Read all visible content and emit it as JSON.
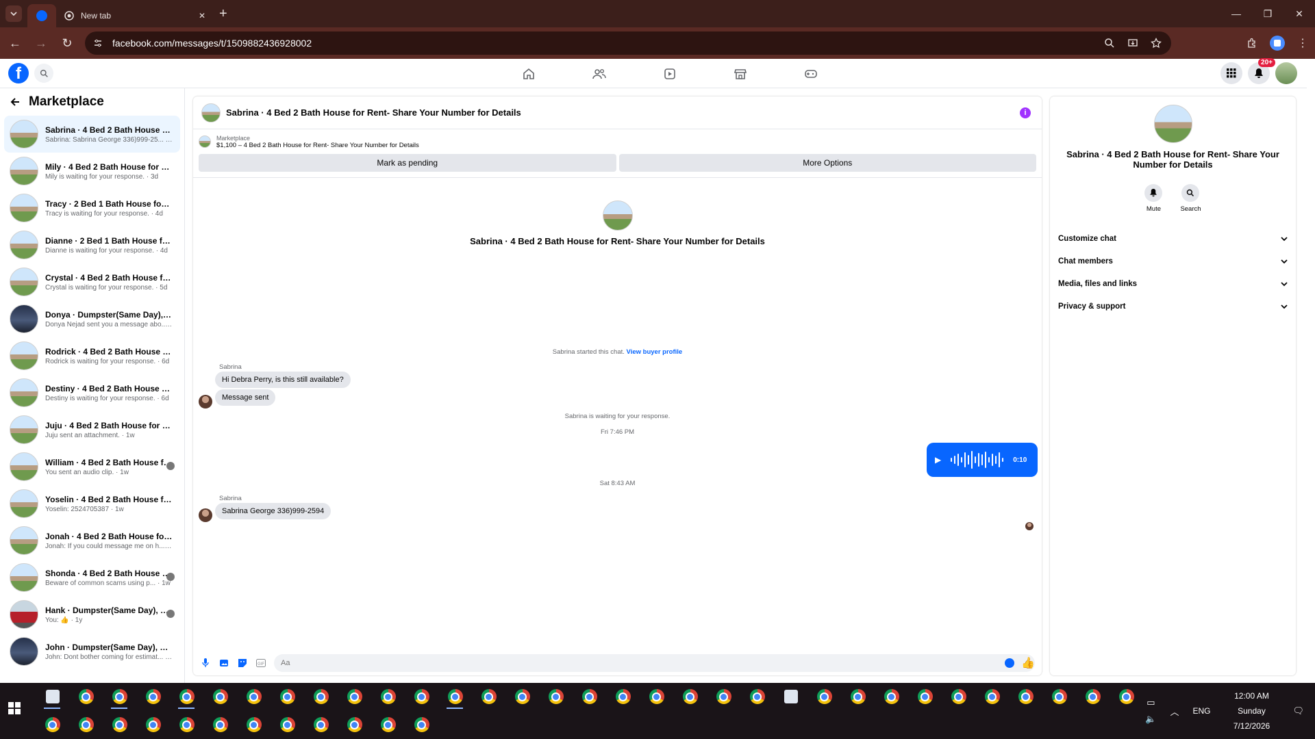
{
  "browser": {
    "tabs": [
      {
        "label": ""
      },
      {
        "label": "New tab"
      }
    ],
    "url": "facebook.com/messages/t/1509882436928002"
  },
  "fb": {
    "notifications_badge": "20+"
  },
  "sidebar": {
    "title": "Marketplace",
    "conversations": [
      {
        "name": "Sabrina · 4 Bed 2 Bath House for R...",
        "preview": "Sabrina: Sabrina George 336)999-25... · 15h",
        "active": true
      },
      {
        "name": "Mily · 4 Bed 2 Bath House for Rent...",
        "preview": "Mily is waiting for your response. · 3d"
      },
      {
        "name": "Tracy · 2 Bed 1 Bath House for Ren...",
        "preview": "Tracy is waiting for your response. · 4d"
      },
      {
        "name": "Dianne · 2 Bed 1 Bath House for R...",
        "preview": "Dianne is waiting for your response. · 4d"
      },
      {
        "name": "Crystal · 4 Bed 2 Bath House for R...",
        "preview": "Crystal is waiting for your response. · 5d"
      },
      {
        "name": "Donya · Dumpster(Same Day), Ren...",
        "preview": "Donya Nejad sent you a message abo... · 6d"
      },
      {
        "name": "Rodrick · 4 Bed 2 Bath House for R...",
        "preview": "Rodrick is waiting for your response. · 6d"
      },
      {
        "name": "Destiny · 4 Bed 2 Bath House for R...",
        "preview": "Destiny is waiting for your response. · 6d"
      },
      {
        "name": "Juju · 4 Bed 2 Bath House for Rent...",
        "preview": "Juju sent an attachment. · 1w"
      },
      {
        "name": "William · 4 Bed 2 Bath House fo...",
        "preview": "You sent an audio clip. · 1w"
      },
      {
        "name": "Yoselin · 4 Bed 2 Bath House for R...",
        "preview": "Yoselin: 2524705387 · 1w"
      },
      {
        "name": "Jonah · 4 Bed 2 Bath House for Re...",
        "preview": "Jonah: If you could message me on h... · 1w"
      },
      {
        "name": "Shonda · 4 Bed 2 Bath House fo...",
        "preview": "Beware of common scams using p... · 1w"
      },
      {
        "name": "Hank · Dumpster(Same Day), Re...",
        "preview": "You: 👍 · 1y"
      },
      {
        "name": "John · Dumpster(Same Day), Rental",
        "preview": "John: Dont bother coming for estimat... · 1y"
      }
    ]
  },
  "chat": {
    "title": "Sabrina · 4 Bed 2 Bath House for Rent- Share Your Number for Details",
    "listing_label": "Marketplace",
    "listing_desc": "$1,100 – 4 Bed 2 Bath House for Rent- Share Your Number for Details",
    "btn_pending": "Mark as pending",
    "btn_more": "More Options",
    "started": "Sabrina started this chat.",
    "view_profile": "View buyer profile",
    "sender1": "Sabrina",
    "msg1": "Hi Debra Perry, is this still available?",
    "msg2": "Message sent",
    "waiting": "Sabrina is waiting for your response.",
    "time1": "Fri 7:46 PM",
    "audio_duration": "0:10",
    "time2": "Sat 8:43 AM",
    "sender2": "Sabrina",
    "msg3": "Sabrina George 336)999-2594",
    "composer_placeholder": "Aa"
  },
  "panel": {
    "title": "Sabrina · 4 Bed 2 Bath House for Rent- Share Your Number for Details",
    "mute": "Mute",
    "search": "Search",
    "rows": [
      "Customize chat",
      "Chat members",
      "Media, files and links",
      "Privacy & support"
    ]
  },
  "taskbar": {
    "lang": "ENG",
    "time": "12:00 AM",
    "day": "Sunday",
    "date": "7/12/2026"
  }
}
